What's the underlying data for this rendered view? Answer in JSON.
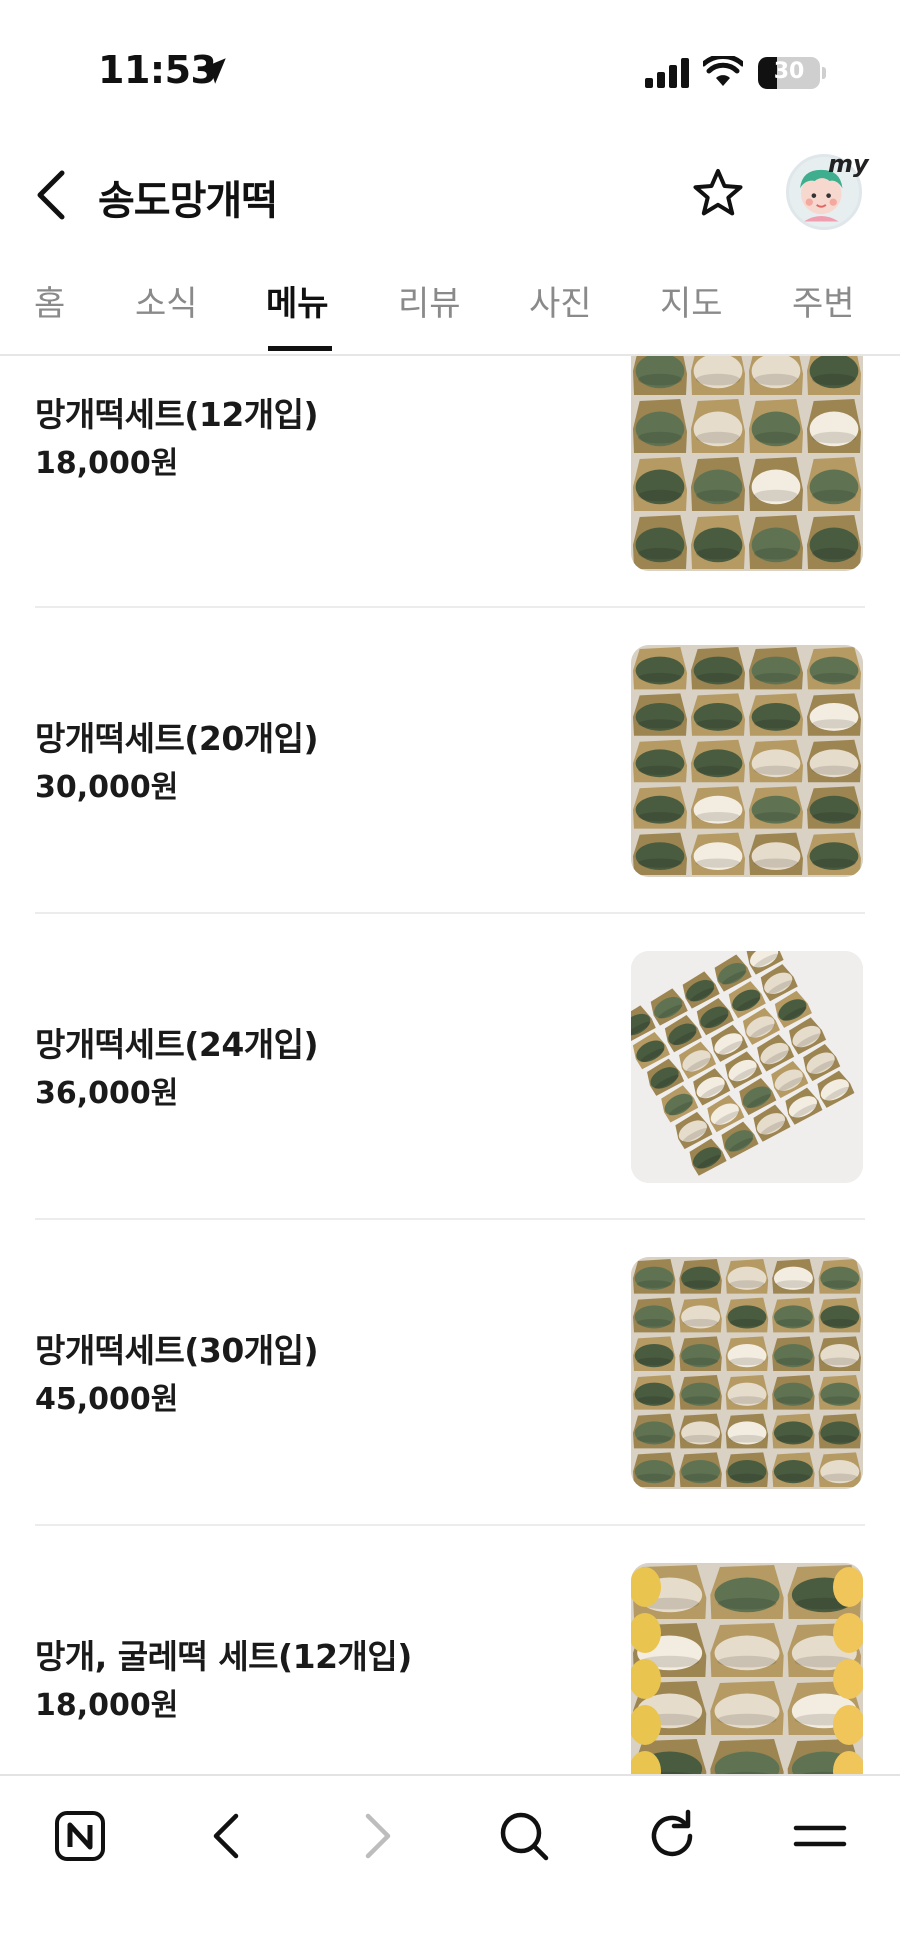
{
  "status_bar": {
    "time": "11:53",
    "battery": "30",
    "battery_level": 0.3
  },
  "header": {
    "title": "송도망개떡",
    "my_badge": "my"
  },
  "tabs": [
    {
      "label": "홈"
    },
    {
      "label": "소식"
    },
    {
      "label": "메뉴"
    },
    {
      "label": "리뷰"
    },
    {
      "label": "사진"
    },
    {
      "label": "지도"
    },
    {
      "label": "주변"
    }
  ],
  "active_tab": "메뉴",
  "menu": {
    "items": [
      {
        "name": "망개떡세트(12개입)",
        "price": "18,000원"
      },
      {
        "name": "망개떡세트(20개입)",
        "price": "30,000원"
      },
      {
        "name": "망개떡세트(24개입)",
        "price": "36,000원"
      },
      {
        "name": "망개떡세트(30개입)",
        "price": "45,000원"
      },
      {
        "name": "망개, 굴레떡 세트(12개입)",
        "price": "18,000원"
      }
    ]
  },
  "bottom_bar": {
    "icons": [
      "naver-icon",
      "back-icon",
      "forward-icon",
      "search-icon",
      "refresh-icon",
      "menu-icon"
    ]
  },
  "colors": {
    "text": "#111111",
    "inactive_tab": "#8a8a8a",
    "divider": "#ececec"
  }
}
